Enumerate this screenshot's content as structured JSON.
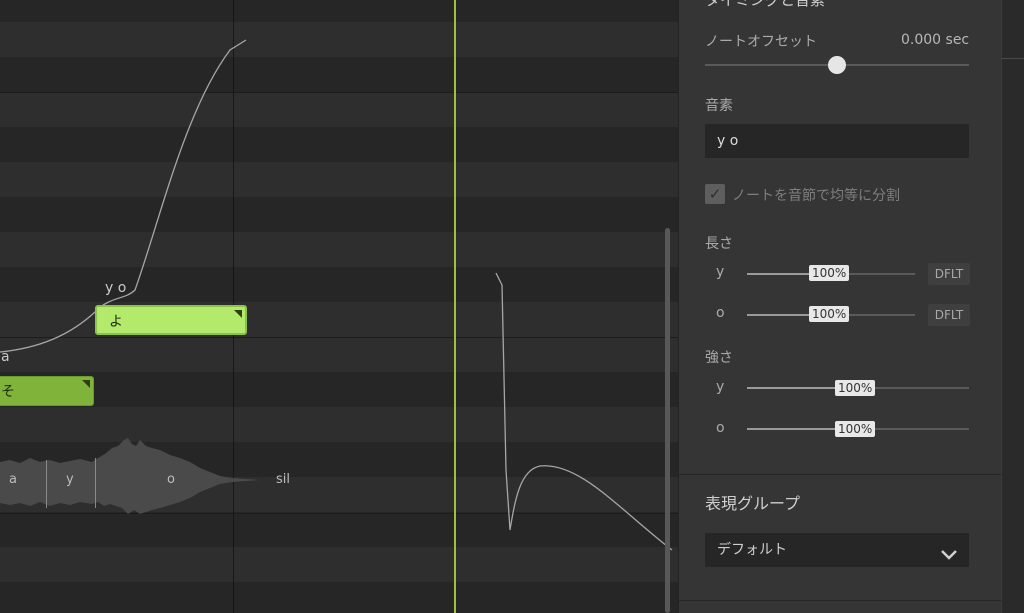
{
  "roll": {
    "notes": [
      {
        "lyric": "よ",
        "phonemes": "y o"
      },
      {
        "lyric": "そ"
      }
    ],
    "prev_phoneme_label": "a",
    "waveform_phonemes": [
      "a",
      "y",
      "o",
      "sil"
    ]
  },
  "inspector": {
    "section_title": "タイミングと音素",
    "note_offset": {
      "label": "ノートオフセット",
      "value": "0.000 sec",
      "position": 0.5
    },
    "phoneme": {
      "label": "音素",
      "value": "y o"
    },
    "split_evenly": {
      "label": "ノートを音節で均等に分割",
      "checked": true
    },
    "length": {
      "label": "長さ",
      "rows": [
        {
          "phoneme": "y",
          "percent": "100%",
          "default_label": "DFLT"
        },
        {
          "phoneme": "o",
          "percent": "100%",
          "default_label": "DFLT"
        }
      ]
    },
    "strength": {
      "label": "強さ",
      "rows": [
        {
          "phoneme": "y",
          "percent": "100%"
        },
        {
          "phoneme": "o",
          "percent": "100%"
        }
      ]
    },
    "expression_group": {
      "title": "表現グループ",
      "value": "デフォルト"
    }
  },
  "colors": {
    "note_selected": "#b4ea6c",
    "note": "#7fb33a",
    "playhead": "#9dc13a",
    "panel_bg": "#353535"
  },
  "icons": {
    "checkbox": "check-icon",
    "select": "chevron-down-icon"
  }
}
